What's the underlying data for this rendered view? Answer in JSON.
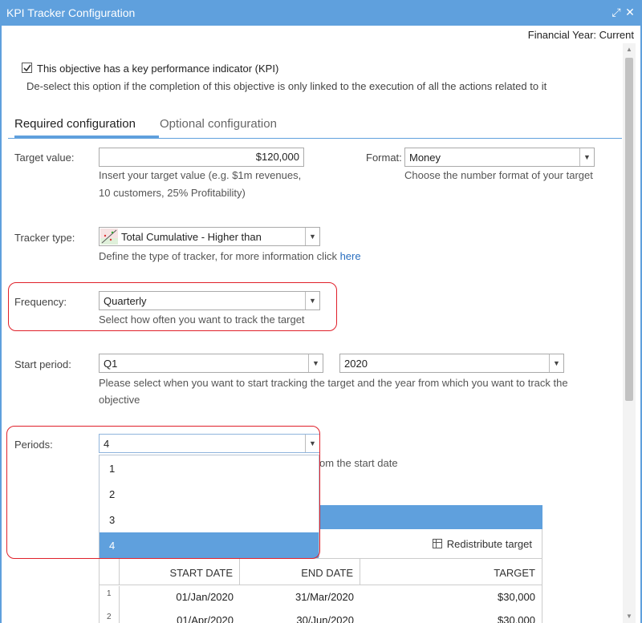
{
  "window": {
    "title": "KPI Tracker Configuration",
    "maximize_glyph": "⤢",
    "close_glyph": "✕",
    "accent": "#5fa0dd"
  },
  "financial_year": "Financial Year: Current",
  "kpi": {
    "checked": true,
    "label": "This objective has a key performance indicator (KPI)",
    "hint": "De-select this option if the completion of this objective is only linked to the execution of all the actions related to it"
  },
  "tabs": [
    {
      "label": "Required configuration",
      "active": true
    },
    {
      "label": "Optional configuration",
      "active": false
    }
  ],
  "target_value": {
    "label": "Target value:",
    "value": "$120,000",
    "hint_line1": "Insert your target value (e.g. $1m revenues,",
    "hint_line2": "10 customers, 25% Profitability)"
  },
  "format": {
    "label": "Format:",
    "value": "Money",
    "hint": "Choose the number format of your target"
  },
  "tracker_type": {
    "label": "Tracker type:",
    "value": "Total Cumulative - Higher than",
    "hint_prefix": "Define the type of tracker, for more information click ",
    "hint_link": "here"
  },
  "frequency": {
    "label": "Frequency:",
    "value": "Quarterly",
    "hint": "Select how often you want to track the target"
  },
  "start_period": {
    "label": "Start period:",
    "period_value": "Q1",
    "year_value": "2020",
    "hint_line1": "Please select when you want to start tracking the target and the year from which you want to track the",
    "hint_line2": "objective"
  },
  "periods": {
    "label": "Periods:",
    "value": "4",
    "hint_partial": "om the start date",
    "options": [
      "1",
      "2",
      "3",
      "4"
    ],
    "selected_index": 3
  },
  "grid": {
    "redistribute_label": "Redistribute target",
    "columns": [
      "START DATE",
      "END DATE",
      "TARGET"
    ],
    "rows": [
      {
        "num": "1",
        "start": "01/Jan/2020",
        "end": "31/Mar/2020",
        "target": "$30,000"
      },
      {
        "num": "2",
        "start": "01/Apr/2020",
        "end": "30/Jun/2020",
        "target": "$30,000"
      }
    ]
  }
}
